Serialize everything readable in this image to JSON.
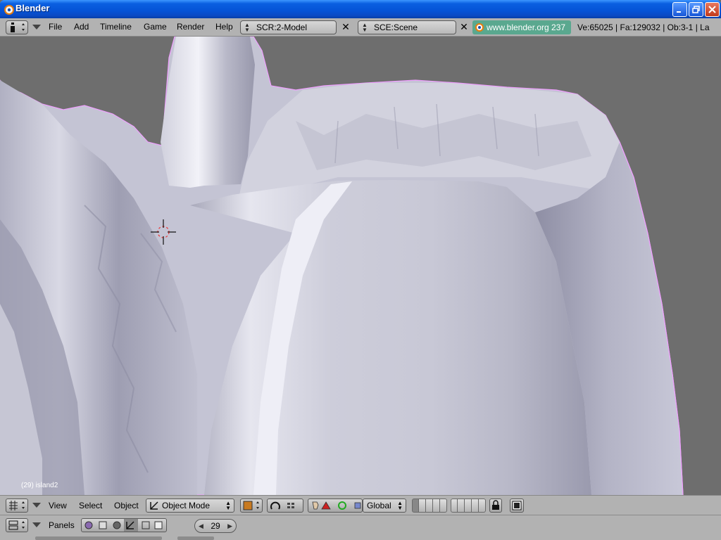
{
  "window": {
    "title": "Blender"
  },
  "topbar": {
    "menus": [
      "File",
      "Add",
      "Timeline",
      "Game",
      "Render",
      "Help"
    ],
    "screen_field": "SCR:2-Model",
    "scene_field": "SCE:Scene",
    "url": "www.blender.org 237",
    "stats": "Ve:65025 | Fa:129032 | Ob:3-1 | La"
  },
  "viewport": {
    "object_label": "(29) island2"
  },
  "view_header": {
    "menus": [
      "View",
      "Select",
      "Object"
    ],
    "mode": "Object Mode",
    "orientation": "Global"
  },
  "buttons_header": {
    "panels_label": "Panels",
    "frame": "29"
  },
  "colors": {
    "xp_blue": "#0553d6",
    "blender_gray": "#b2b2b2",
    "viewport_bg": "#6e6e6e",
    "terrain": "#c8c8d8",
    "selection_outline": "#f0a0ff",
    "url_bg": "#5aa88f"
  }
}
